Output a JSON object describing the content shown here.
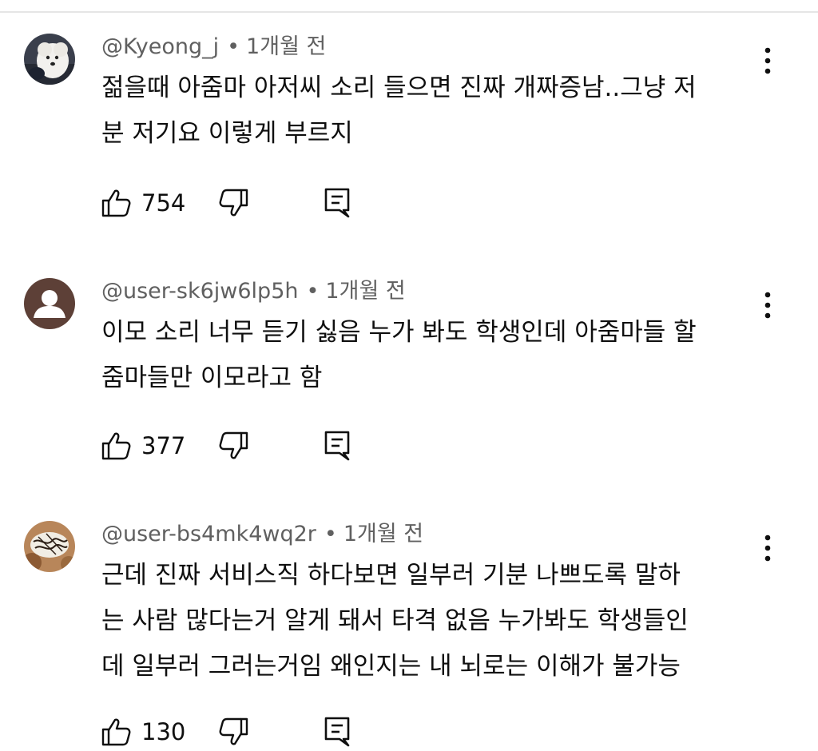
{
  "comments": [
    {
      "author": "@Kyeong_j",
      "separator": "•",
      "time": "1개월 전",
      "lines": [
        "젊을때 아줌마 아저씨 소리 들으면 진짜 개짜증남..그냥 저",
        "분 저기요 이렇게 부르지"
      ],
      "likes": "754",
      "avatar_icon": "white-dog-avatar"
    },
    {
      "author": "@user-sk6jw6lp5h",
      "separator": "•",
      "time": "1개월 전",
      "lines": [
        "이모 소리 너무 듣기 싫음 누가 봐도 학생인데 아줌마들 할",
        "줌마들만 이모라고 함"
      ],
      "likes": "377",
      "avatar_icon": "default-user-avatar"
    },
    {
      "author": "@user-bs4mk4wq2r",
      "separator": "•",
      "time": "1개월 전",
      "lines": [
        "근데 진짜 서비스직 하다보면 일부러 기분 나쁘도록 말하",
        "는 사람 많다는거 알게 돼서 타격 없음 누가봐도 학생들인",
        "데 일부러 그러는거임 왜인지는 내 뇌로는 이해가 불가능"
      ],
      "likes": "130",
      "avatar_icon": "dessert-avatar"
    }
  ],
  "icons": {
    "like": "thumbs-up-icon",
    "dislike": "thumbs-down-icon",
    "reply": "reply-comment-icon",
    "more": "more-vertical-icon"
  },
  "colors": {
    "text": "#0f0f0f",
    "meta": "#606060",
    "divider": "#e5e5e5"
  }
}
